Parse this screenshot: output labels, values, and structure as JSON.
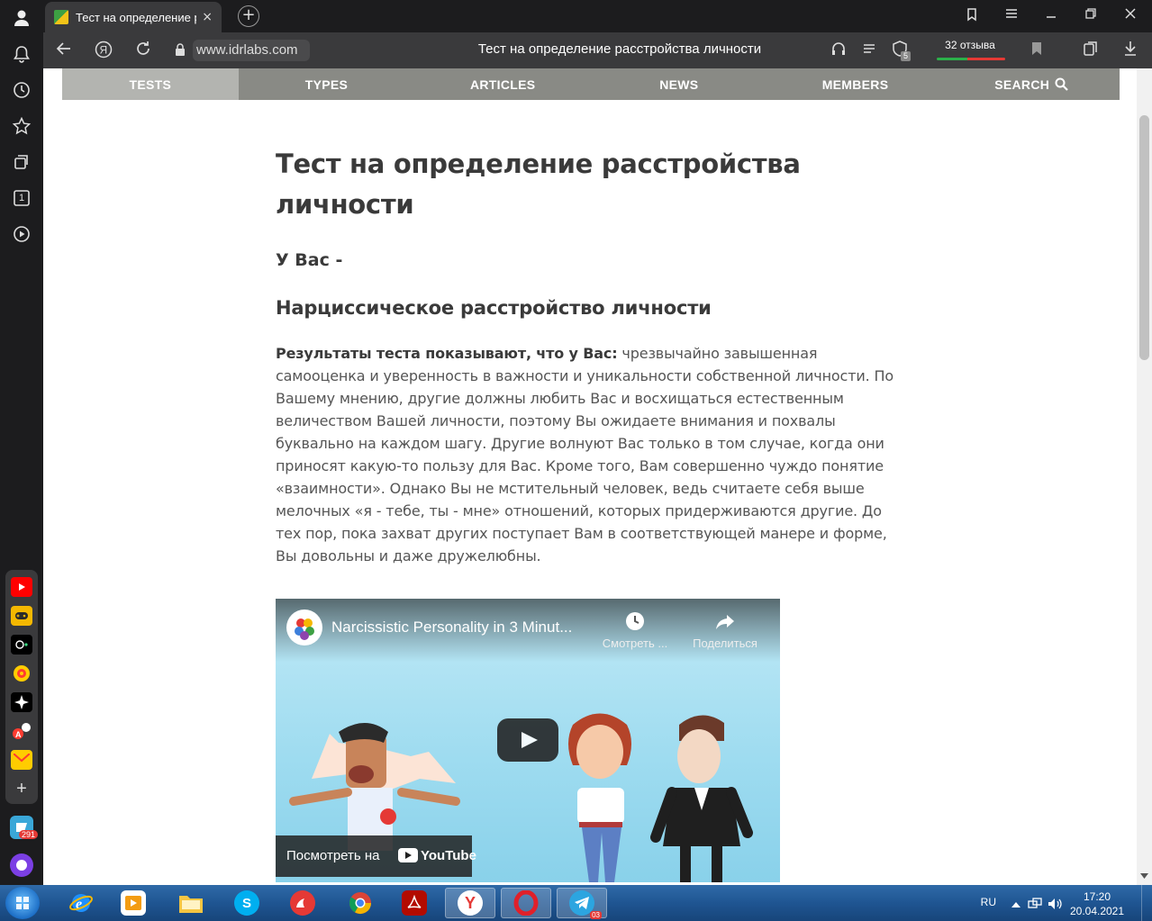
{
  "browser": {
    "tab_title": "Тест на определение расстройства личности",
    "tab_close": "×",
    "new_tab": "+",
    "url": "www.idrlabs.com",
    "page_title": "Тест на определение расстройства личности",
    "reviews_label": "32 отзыва",
    "shield_badge": "5"
  },
  "sidebar": {
    "icons": [
      "profile-icon",
      "bell-icon",
      "history-icon",
      "star-icon",
      "collections-icon",
      "tab-counter-icon",
      "video-icon"
    ],
    "tab_counter": "1"
  },
  "site_nav": {
    "items": [
      {
        "label": "TESTS"
      },
      {
        "label": "TYPES"
      },
      {
        "label": "ARTICLES"
      },
      {
        "label": "NEWS"
      },
      {
        "label": "MEMBERS"
      },
      {
        "label": "SEARCH"
      }
    ]
  },
  "article": {
    "title": "Тест на определение расстройства личности",
    "subtitle": "У Вас -",
    "result": "Нарциссическое расстройство личности",
    "lead_bold": "Результаты теста показывают, что у Вас:",
    "body": " чрезвычайно завышенная самооценка и уверенность в важности и уникальности собственной личности. По Вашему мнению, другие должны любить Вас и восхищаться естественным величеством Вашей личности, поэтому Вы ожидаете внимания и похвалы буквально на каждом шагу. Другие волнуют Вас только в том случае, когда они приносят какую-то пользу для Вас. Кроме того, Вам совершенно чуждо понятие «взаимности». Однако Вы не мстительный человек, ведь считаете себя выше мелочных «я - тебе, ты - мне» отношений, которых придерживаются другие. До тех пор, пока захват других поступает Вам в соответствующей манере и форме, Вы довольны и даже дружелюбны."
  },
  "video": {
    "title": "Narcissistic Personality in 3 Minut...",
    "watch_later": "Смотреть ...",
    "share": "Поделиться",
    "watch_on": "Посмотреть на",
    "youtube": "YouTube"
  },
  "dock": {
    "mail_badge": "291"
  },
  "taskbar": {
    "lang": "RU",
    "time": "17:20",
    "date": "20.04.2021",
    "telegram_badge": "03"
  },
  "colors": {
    "nav_bg": "#898a85",
    "nav_active": "#b3b4b0",
    "browser_dark": "#1c1c1e",
    "toolbar": "#3a3a3c"
  }
}
